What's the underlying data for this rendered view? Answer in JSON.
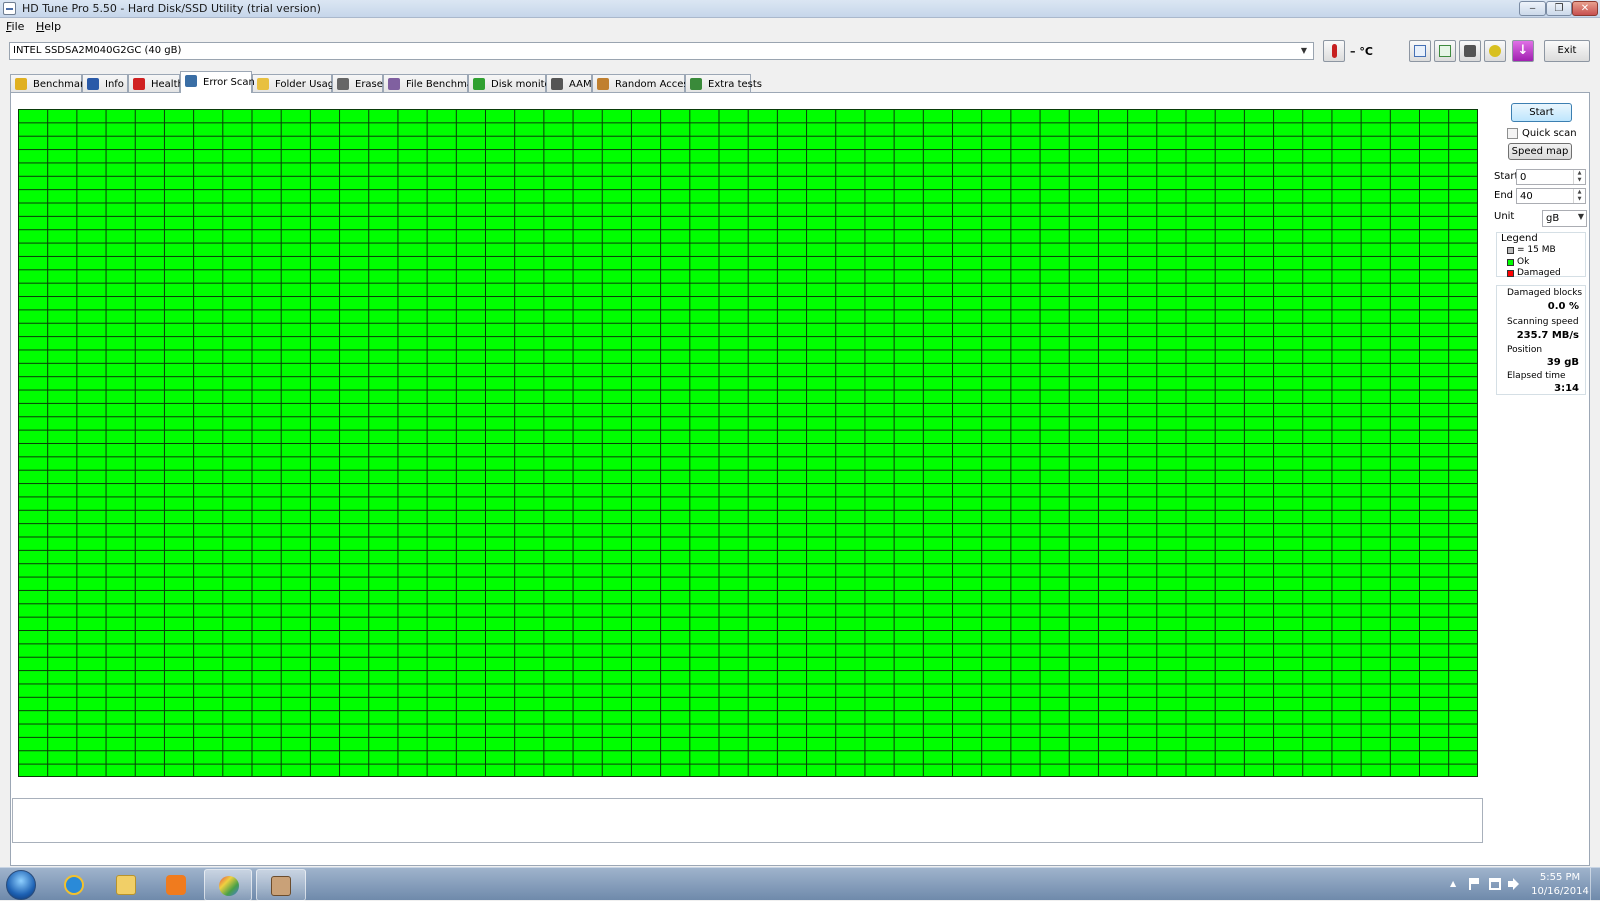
{
  "window": {
    "title": "HD Tune Pro 5.50 - Hard Disk/SSD Utility (trial version)",
    "minimize": "‒",
    "maximize": "❐",
    "close": "✕"
  },
  "menu": {
    "file": "File",
    "help": "Help"
  },
  "toolbar": {
    "drive": "INTEL SSDSA2M040G2GC (40 gB)",
    "temperature": "– °C",
    "exit_label": "Exit",
    "icons": [
      "copy-text-icon",
      "copy-screenshot-icon",
      "camera-icon",
      "options-icon",
      "save-icon"
    ]
  },
  "tabs": [
    {
      "label": "Benchmark",
      "icon": "benchmark-icon",
      "color": "#e0b020"
    },
    {
      "label": "Info",
      "icon": "info-icon",
      "color": "#2a5aa8"
    },
    {
      "label": "Health",
      "icon": "health-icon",
      "color": "#d02020"
    },
    {
      "label": "Error Scan",
      "icon": "magnifier-icon",
      "color": "#3a6ea5",
      "active": true
    },
    {
      "label": "Folder Usage",
      "icon": "folder-icon",
      "color": "#e8c040"
    },
    {
      "label": "Erase",
      "icon": "trash-icon",
      "color": "#666666"
    },
    {
      "label": "File Benchmark",
      "icon": "file-benchmark-icon",
      "color": "#8060a0"
    },
    {
      "label": "Disk monitor",
      "icon": "disk-monitor-icon",
      "color": "#30a030"
    },
    {
      "label": "AAM",
      "icon": "speaker-icon",
      "color": "#555555"
    },
    {
      "label": "Random Access",
      "icon": "random-access-icon",
      "color": "#c08030"
    },
    {
      "label": "Extra tests",
      "icon": "extra-tests-icon",
      "color": "#3a8a3a"
    }
  ],
  "scan": {
    "block_status": "all-ok",
    "ok_color": "#00ff00",
    "damaged_color": "#ff0000"
  },
  "controls": {
    "start_label": "Start",
    "quick_scan_label": "Quick scan",
    "quick_scan_checked": false,
    "speed_map_label": "Speed map",
    "start_field_label": "Start",
    "start_value": "0",
    "end_field_label": "End",
    "end_value": "40",
    "unit_label": "Unit",
    "unit_value": "gB"
  },
  "legend": {
    "title": "Legend",
    "block_size": "= 15 MB",
    "ok": "Ok",
    "damaged": "Damaged"
  },
  "stats": {
    "damaged_blocks_label": "Damaged blocks",
    "damaged_blocks_value": "0.0 %",
    "scanning_speed_label": "Scanning speed",
    "scanning_speed_value": "235.7 MB/s",
    "position_label": "Position",
    "position_value": "39 gB",
    "elapsed_time_label": "Elapsed time",
    "elapsed_time_value": "3:14"
  },
  "taskbar": {
    "clock_time": "5:55 PM",
    "clock_date": "10/16/2014"
  }
}
